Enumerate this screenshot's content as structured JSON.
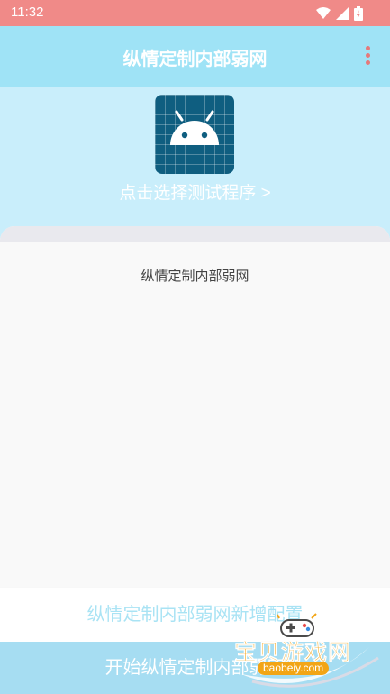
{
  "status_bar": {
    "time": "11:32",
    "icons": [
      "wifi-icon",
      "signal-icon",
      "battery-icon"
    ],
    "background": "#f08a88"
  },
  "app_bar": {
    "title": "纵情定制内部弱网",
    "menu_icon": "overflow-menu-icon",
    "background": "#9fe3f6"
  },
  "hero": {
    "app_icon": "android-app-icon",
    "select_label": "点击选择测试程序 >",
    "background": "#c9eefb"
  },
  "card": {
    "text": "纵情定制内部弱网"
  },
  "buttons": {
    "new_config": "纵情定制内部弱网新增配置",
    "start": "开始纵情定制内部弱网"
  },
  "watermark": {
    "title": "宝贝游戏网",
    "url": "baobeiy.com"
  },
  "colors": {
    "accent": "#9fe3f6",
    "accent_light": "#c9eefb",
    "menu_dots": "#e5797b",
    "watermark": "#f2a516"
  }
}
